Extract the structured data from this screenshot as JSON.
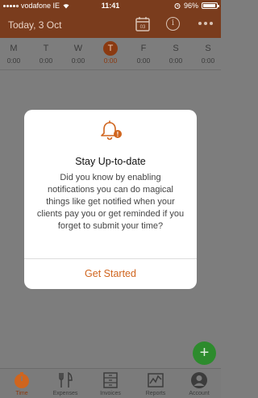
{
  "status_bar": {
    "carrier": "vodafone IE",
    "time": "11:41",
    "battery": "96%",
    "battery_level": 0.96
  },
  "header": {
    "date": "Today, 3 Oct",
    "calendar_day": "03"
  },
  "week": {
    "days": [
      {
        "letter": "M",
        "hours": "0:00"
      },
      {
        "letter": "T",
        "hours": "0:00"
      },
      {
        "letter": "W",
        "hours": "0:00"
      },
      {
        "letter": "T",
        "hours": "0:00"
      },
      {
        "letter": "F",
        "hours": "0:00"
      },
      {
        "letter": "S",
        "hours": "0:00"
      },
      {
        "letter": "S",
        "hours": "0:00"
      }
    ],
    "active_day": 3
  },
  "modal": {
    "title": "Stay Up-to-date",
    "body": "Did you know by enabling notifications you can do magical things like get notified when your clients pay you or get reminded if you forget to submit your time?",
    "button": "Get Started",
    "badge": "!"
  },
  "fab": {
    "icon": "plus-icon",
    "symbol": "+"
  },
  "tabbar": {
    "items": [
      {
        "label": "Time",
        "icon": "stopwatch-icon"
      },
      {
        "label": "Expenses",
        "icon": "cutlery-icon"
      },
      {
        "label": "Invoices",
        "icon": "cabinet-icon"
      },
      {
        "label": "Reports",
        "icon": "chart-icon"
      },
      {
        "label": "Account",
        "icon": "user-icon"
      }
    ]
  },
  "colors": {
    "accent": "#d0651e",
    "header_bg": "#7a3c1d",
    "fab_green": "#2d8b2d"
  }
}
